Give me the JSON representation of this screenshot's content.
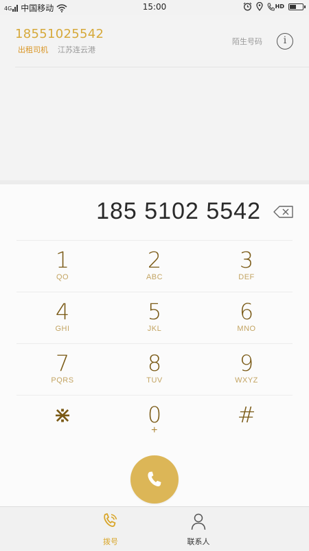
{
  "status_bar": {
    "signal_label": "4G",
    "carrier": "中国移动",
    "time": "15:00",
    "volte_label": "HD",
    "battery_level": 0.55
  },
  "contact_match": {
    "number": "18551025542",
    "tag": "出租司机",
    "location": "江苏连云港",
    "stranger_label": "陌生号码",
    "info_glyph": "i"
  },
  "dialer": {
    "entered_number": "185 5102 5542",
    "keys": [
      [
        {
          "digit": "1",
          "letters": "QO"
        },
        {
          "digit": "2",
          "letters": "ABC"
        },
        {
          "digit": "3",
          "letters": "DEF"
        }
      ],
      [
        {
          "digit": "4",
          "letters": "GHI"
        },
        {
          "digit": "5",
          "letters": "JKL"
        },
        {
          "digit": "6",
          "letters": "MNO"
        }
      ],
      [
        {
          "digit": "7",
          "letters": "PQRS"
        },
        {
          "digit": "8",
          "letters": "TUV"
        },
        {
          "digit": "9",
          "letters": "WXYZ"
        }
      ],
      [
        {
          "digit": "⋇",
          "letters": ""
        },
        {
          "digit": "0",
          "letters": "+"
        },
        {
          "digit": "#",
          "letters": ""
        }
      ]
    ]
  },
  "bottom_nav": {
    "dial_label": "拨号",
    "contacts_label": "联系人"
  },
  "colors": {
    "accent": "#dcb657",
    "key_digit": "#7a5a16",
    "number_highlight": "#d6a93a",
    "tag_color": "#d99524"
  }
}
